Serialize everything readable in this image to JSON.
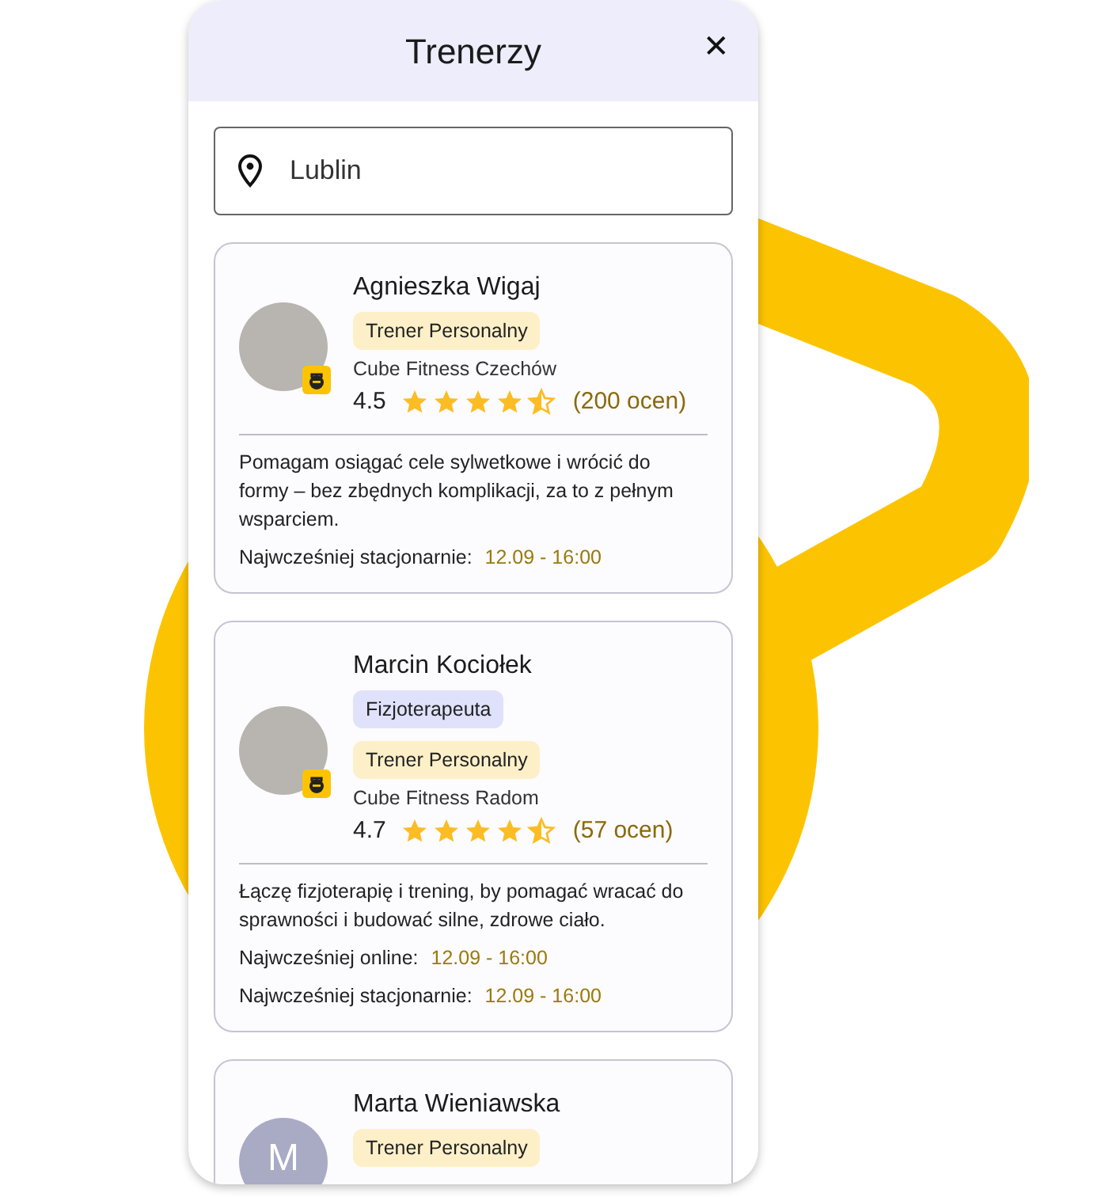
{
  "header": {
    "title": "Trenerzy",
    "close": "✕"
  },
  "search": {
    "value": "Lublin"
  },
  "trainers": [
    {
      "name": "Agnieszka Wigaj",
      "avatar": {
        "kind": "photo"
      },
      "tags": [
        {
          "label": "Trener Personalny",
          "color": "#fdf0c8"
        }
      ],
      "gym": "Cube Fitness Czechów",
      "rating": "4.5",
      "stars": 4.5,
      "reviews": "(200 ocen)",
      "bio": "Pomagam osiągać cele sylwetkowe i wrócić do formy – bez zbędnych komplikacji, za to z pełnym wsparciem.",
      "availability": [
        {
          "label": "Najwcześniej stacjonarnie:",
          "value": "12.09 - 16:00"
        }
      ]
    },
    {
      "name": "Marcin Kociołek",
      "avatar": {
        "kind": "photo"
      },
      "tags": [
        {
          "label": "Fizjoterapeuta",
          "color": "#e0e2fb"
        },
        {
          "label": "Trener Personalny",
          "color": "#fdf0c8"
        }
      ],
      "gym": "Cube Fitness Radom",
      "rating": "4.7",
      "stars": 4.5,
      "reviews": "(57 ocen)",
      "bio": "Łączę fizjoterapię i trening, by pomagać wracać do sprawności i budować silne, zdrowe ciało.",
      "availability": [
        {
          "label": "Najwcześniej online:",
          "value": "12.09 - 16:00"
        },
        {
          "label": "Najwcześniej stacjonarnie:",
          "value": "12.09 - 16:00"
        }
      ]
    },
    {
      "name": "Marta Wieniawska",
      "avatar": {
        "kind": "initial",
        "initial": "M"
      },
      "tags": [
        {
          "label": "Trener Personalny",
          "color": "#fdf0c8"
        }
      ]
    }
  ]
}
